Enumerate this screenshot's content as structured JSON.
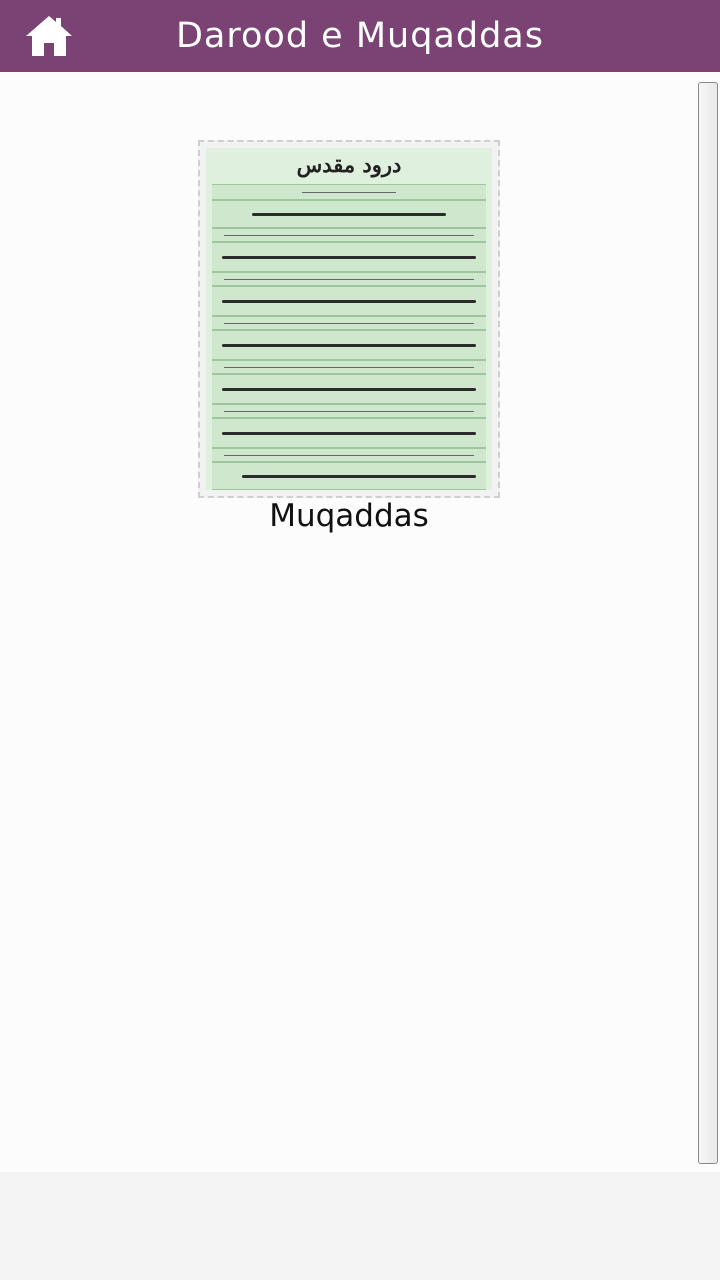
{
  "header": {
    "title": "Darood e Muqaddas",
    "home_icon": "home-icon",
    "background_color": "#7b4373"
  },
  "main": {
    "image": {
      "heading_text": "درود مقدس",
      "alt": "Darood e Muqaddas Urdu text image"
    },
    "caption": "Muqaddas"
  }
}
